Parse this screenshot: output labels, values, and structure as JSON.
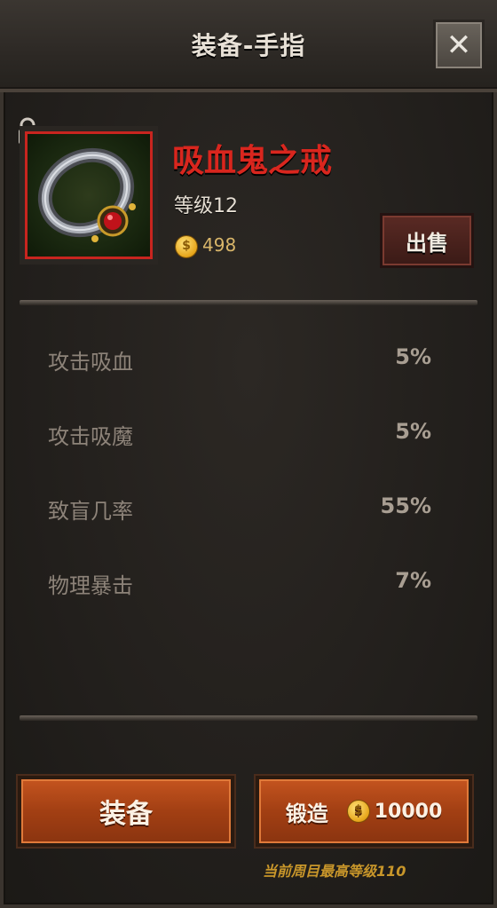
{
  "header": {
    "title": "装备-手指",
    "close_icon": "close-icon"
  },
  "item": {
    "name": "吸血鬼之戒",
    "level": "等级12",
    "price": "498",
    "icon": "vampire-ring-icon",
    "locked_icon": "lock-icon",
    "frame_color": "#c8251f",
    "sell_label": "出售"
  },
  "stats": [
    {
      "label": "攻击吸血",
      "value": "5%"
    },
    {
      "label": "攻击吸魔",
      "value": "5%"
    },
    {
      "label": "致盲几率",
      "value": "55%"
    },
    {
      "label": "物理暴击",
      "value": "7%"
    }
  ],
  "actions": {
    "equip_label": "装备",
    "forge_label": "锻造",
    "forge_cost": "10000"
  },
  "footnote": "当前周目最高等级110",
  "colors": {
    "name_red": "#d9261e",
    "button_orange": "#b14a17",
    "gold": "#e6a51a"
  }
}
